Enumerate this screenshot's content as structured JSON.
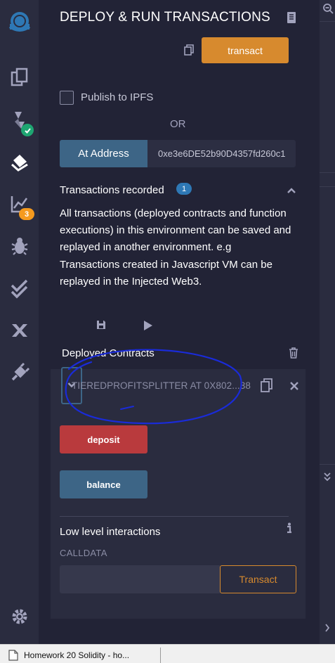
{
  "sidebar": {
    "icons": [
      "remix-logo-icon",
      "file-explorer-icon",
      "solidity-compiler-icon",
      "deploy-run-icon",
      "analysis-icon",
      "debugger-icon",
      "unit-test-icon",
      "plugin-icon",
      "plugin-manager-icon",
      "settings-icon"
    ],
    "badge_count": "3"
  },
  "header": {
    "title": "DEPLOY & RUN TRANSACTIONS"
  },
  "deploy": {
    "transact_label": "transact"
  },
  "publish": {
    "label": "Publish to IPFS",
    "checked": false
  },
  "or_label": "OR",
  "at_address": {
    "button_label": "At Address",
    "value": "0xe3e6DE52b90D4357fd260c1"
  },
  "transactions": {
    "title": "Transactions recorded",
    "count": "1",
    "description": "All transactions (deployed contracts and function executions) in this environment can be saved and replayed in another environment. e.g Transactions created in Javascript VM can be replayed in the Injected Web3."
  },
  "deployed": {
    "title": "Deployed Contracts",
    "contract": {
      "name": "TIEREDPROFITSPLITTER AT 0X802...38",
      "functions": [
        {
          "label": "deposit",
          "color": "#b93a3d"
        },
        {
          "label": "balance",
          "color": "#3d6586"
        }
      ],
      "low_level": {
        "title": "Low level interactions",
        "calldata_label": "CALLDATA",
        "calldata_value": "",
        "transact_label": "Transact"
      }
    }
  },
  "colors": {
    "accent": "#d78a2e",
    "blue": "#3d6586",
    "red": "#b93a3d",
    "annotation": "#1a2bd9"
  },
  "taskbar": {
    "item_label": "Homework 20 Solidity - ho..."
  }
}
